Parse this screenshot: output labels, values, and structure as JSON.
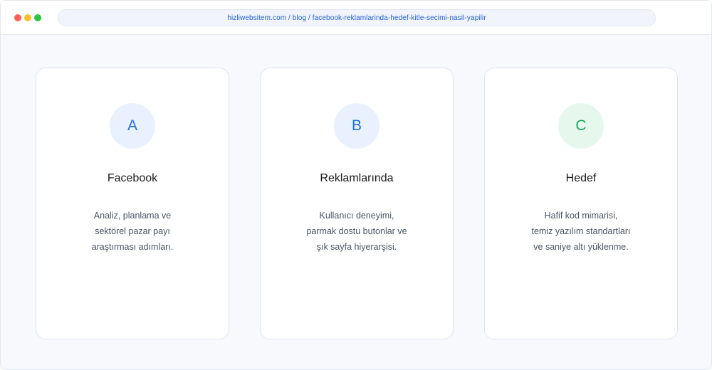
{
  "window": {
    "controls": [
      {
        "name": "close",
        "color": "#ff5f57"
      },
      {
        "name": "minimize",
        "color": "#febc2e"
      },
      {
        "name": "maximize",
        "color": "#28c840"
      }
    ],
    "url": "hizliwebsitem.com / blog / facebook-reklamlarinda-hedef-kitle-secimi-nasil-yapilir"
  },
  "cards": [
    {
      "letter": "A",
      "title": "Facebook",
      "desc": [
        "Analiz, planlama ve",
        "sektörel pazar payı",
        "araştırması adımları."
      ],
      "badge_bg": "#e8f1fd",
      "badge_fg": "#1f6fe5"
    },
    {
      "letter": "B",
      "title": "Reklamlarında",
      "desc": [
        "Kullanıcı deneyimi,",
        "parmak dostu butonlar ve",
        "şık sayfa hiyerarşisi."
      ],
      "badge_bg": "#e8f1fd",
      "badge_fg": "#1f6fe5"
    },
    {
      "letter": "C",
      "title": "Hedef",
      "desc": [
        "Hafif kod mimarisi,",
        "temiz yazılım standartları",
        "ve saniye altı yüklenme."
      ],
      "badge_bg": "#e6f8ee",
      "badge_fg": "#18a957"
    }
  ]
}
